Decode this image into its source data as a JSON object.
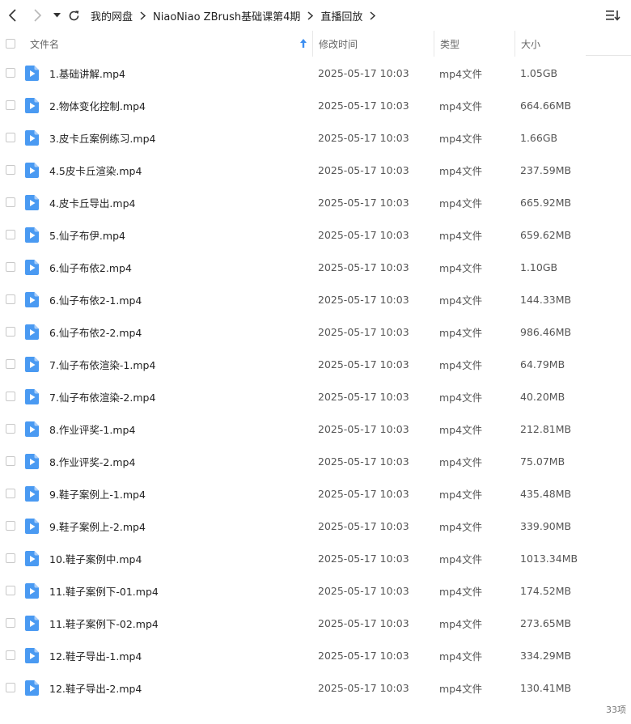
{
  "nav": {
    "back_icon": "chevron-left-icon",
    "forward_icon": "chevron-right-icon",
    "dropdown_icon": "caret-down-icon",
    "refresh_icon": "refresh-icon",
    "breadcrumbs": [
      "我的网盘",
      "NiaoNiao ZBrush基础课第4期",
      "直播回放"
    ],
    "view_icon": "list-view-icon"
  },
  "header": {
    "name": "文件名",
    "date": "修改时间",
    "type": "类型",
    "size": "大小",
    "sort": "ascending"
  },
  "files": [
    {
      "name": "1.基础讲解.mp4",
      "date": "2025-05-17 10:03",
      "type": "mp4文件",
      "size": "1.05GB"
    },
    {
      "name": "2.物体变化控制.mp4",
      "date": "2025-05-17 10:03",
      "type": "mp4文件",
      "size": "664.66MB"
    },
    {
      "name": "3.皮卡丘案例练习.mp4",
      "date": "2025-05-17 10:03",
      "type": "mp4文件",
      "size": "1.66GB"
    },
    {
      "name": "4.5皮卡丘渲染.mp4",
      "date": "2025-05-17 10:03",
      "type": "mp4文件",
      "size": "237.59MB"
    },
    {
      "name": "4.皮卡丘导出.mp4",
      "date": "2025-05-17 10:03",
      "type": "mp4文件",
      "size": "665.92MB"
    },
    {
      "name": "5.仙子布伊.mp4",
      "date": "2025-05-17 10:03",
      "type": "mp4文件",
      "size": "659.62MB"
    },
    {
      "name": "6.仙子布依2.mp4",
      "date": "2025-05-17 10:03",
      "type": "mp4文件",
      "size": "1.10GB"
    },
    {
      "name": "6.仙子布依2-1.mp4",
      "date": "2025-05-17 10:03",
      "type": "mp4文件",
      "size": "144.33MB"
    },
    {
      "name": "6.仙子布依2-2.mp4",
      "date": "2025-05-17 10:03",
      "type": "mp4文件",
      "size": "986.46MB"
    },
    {
      "name": "7.仙子布依渲染-1.mp4",
      "date": "2025-05-17 10:03",
      "type": "mp4文件",
      "size": "64.79MB"
    },
    {
      "name": "7.仙子布依渲染-2.mp4",
      "date": "2025-05-17 10:03",
      "type": "mp4文件",
      "size": "40.20MB"
    },
    {
      "name": "8.作业评奖-1.mp4",
      "date": "2025-05-17 10:03",
      "type": "mp4文件",
      "size": "212.81MB"
    },
    {
      "name": "8.作业评奖-2.mp4",
      "date": "2025-05-17 10:03",
      "type": "mp4文件",
      "size": "75.07MB"
    },
    {
      "name": "9.鞋子案例上-1.mp4",
      "date": "2025-05-17 10:03",
      "type": "mp4文件",
      "size": "435.48MB"
    },
    {
      "name": "9.鞋子案例上-2.mp4",
      "date": "2025-05-17 10:03",
      "type": "mp4文件",
      "size": "339.90MB"
    },
    {
      "name": "10.鞋子案例中.mp4",
      "date": "2025-05-17 10:03",
      "type": "mp4文件",
      "size": "1013.34MB"
    },
    {
      "name": "11.鞋子案例下-01.mp4",
      "date": "2025-05-17 10:03",
      "type": "mp4文件",
      "size": "174.52MB"
    },
    {
      "name": "11.鞋子案例下-02.mp4",
      "date": "2025-05-17 10:03",
      "type": "mp4文件",
      "size": "273.65MB"
    },
    {
      "name": "12.鞋子导出-1.mp4",
      "date": "2025-05-17 10:03",
      "type": "mp4文件",
      "size": "334.29MB"
    },
    {
      "name": "12.鞋子导出-2.mp4",
      "date": "2025-05-17 10:03",
      "type": "mp4文件",
      "size": "130.41MB"
    }
  ],
  "file_icon": "video-file-icon",
  "status": {
    "count": "33项"
  },
  "colors": {
    "accent": "#3d8ef0",
    "icon_fill": "#4a9af2"
  }
}
